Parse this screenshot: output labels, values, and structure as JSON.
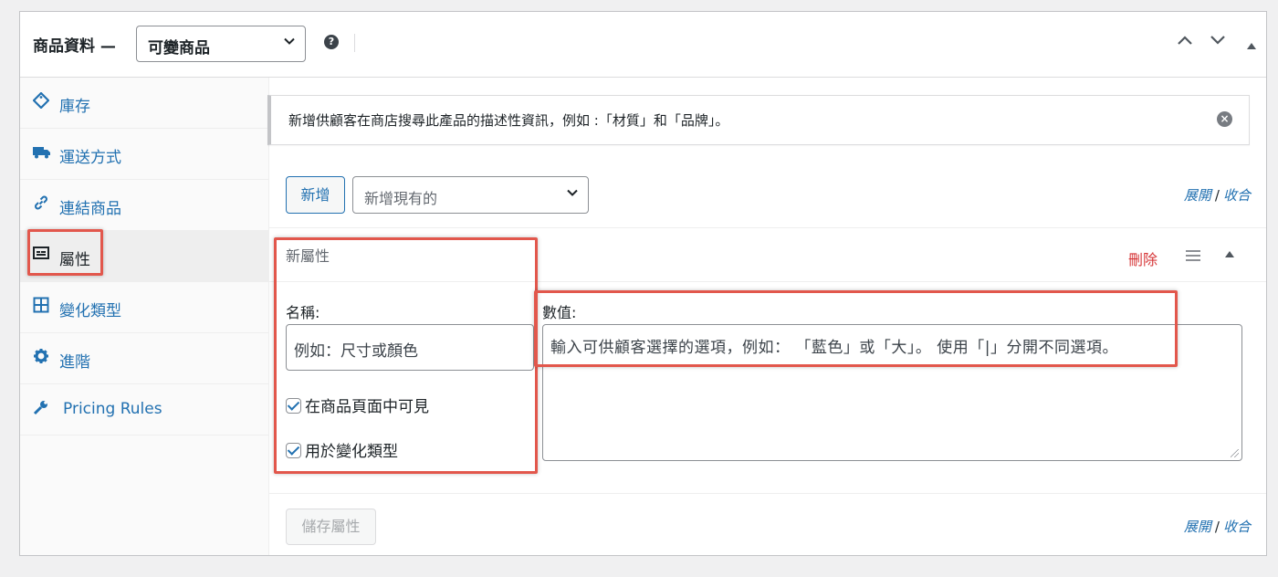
{
  "header": {
    "title": "商品資料 —",
    "product_type": "可變商品",
    "help_icon": "question-icon",
    "controls": [
      "chevron-up-icon",
      "chevron-down-icon",
      "triangle-up-icon"
    ]
  },
  "sidebar": {
    "items": [
      {
        "label": "庫存",
        "icon": "tag-icon"
      },
      {
        "label": "運送方式",
        "icon": "truck-icon"
      },
      {
        "label": "連結商品",
        "icon": "link-icon"
      },
      {
        "label": "屬性",
        "icon": "list-card-icon",
        "active": true
      },
      {
        "label": "變化類型",
        "icon": "grid-icon"
      },
      {
        "label": "進階",
        "icon": "gear-icon"
      },
      {
        "label": "Pricing Rules",
        "icon": "wrench-icon"
      }
    ]
  },
  "notice": {
    "message": "新增供顧客在商店搜尋此產品的描述性資訊，例如 :「材質」和「品牌」。"
  },
  "toolbar": {
    "add_label": "新增",
    "existing_placeholder": "新增現有的",
    "expand_label": "展開",
    "separator": "/",
    "collapse_label": "收合"
  },
  "attribute": {
    "title": "新屬性",
    "delete_label": "刪除",
    "name_label": "名稱:",
    "name_placeholder": "例如：尺寸或顏色",
    "values_label": "數值:",
    "values_placeholder": "輸入可供顧客選擇的選項，例如： 「藍色」或「大」。 使用「|」分開不同選項。",
    "visible_label": "在商品頁面中可見",
    "visible_checked": true,
    "variation_label": "用於變化類型",
    "variation_checked": true
  },
  "footer": {
    "save_label": "儲存屬性",
    "expand_label": "展開",
    "separator": "/",
    "collapse_label": "收合"
  },
  "colors": {
    "link": "#2271b1",
    "delete": "#d63638",
    "highlight": "#e2574c"
  }
}
